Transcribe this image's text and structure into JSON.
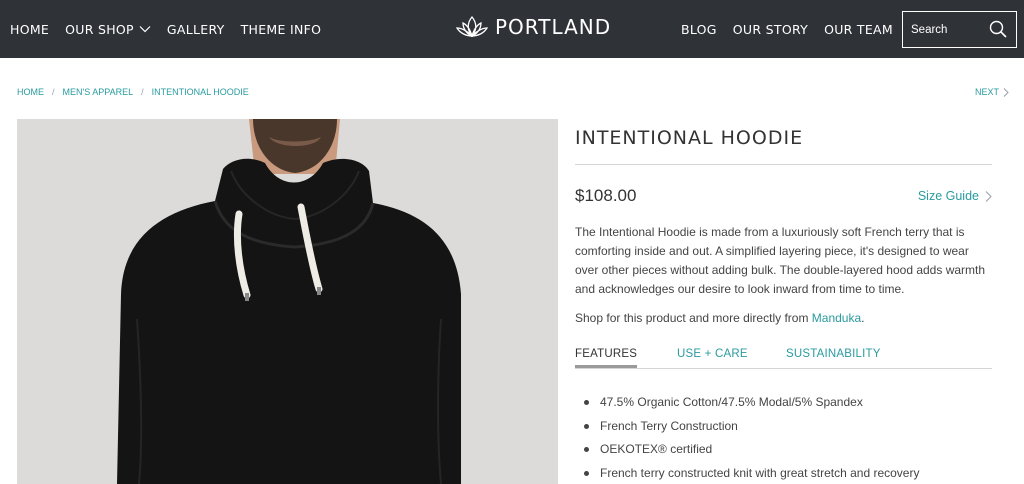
{
  "header": {
    "nav_left": [
      "HOME",
      "OUR SHOP",
      "GALLERY",
      "THEME INFO"
    ],
    "logo_text": "PORTLAND",
    "nav_right": [
      "BLOG",
      "OUR STORY",
      "OUR TEAM"
    ],
    "search_placeholder": "Search"
  },
  "breadcrumb": [
    "HOME",
    "MEN'S APPAREL",
    "INTENTIONAL HOODIE"
  ],
  "next_label": "NEXT",
  "product": {
    "title": "INTENTIONAL HOODIE",
    "price": "$108.00",
    "size_guide": "Size Guide",
    "description": "The Intentional Hoodie is made from a luxuriously soft French terry that is comforting inside and out. A simplified layering piece, it's designed to wear over other pieces without adding bulk. The double-layered hood adds warmth and acknowledges our desire to look inward from time to time.",
    "shop_prefix": "Shop for this product and more directly from ",
    "shop_link": "Manduka",
    "shop_suffix": "."
  },
  "tabs": [
    "FEATURES",
    "USE + CARE",
    "SUSTAINABILITY"
  ],
  "features": [
    "47.5% Organic Cotton/47.5% Modal/5% Spandex",
    "French Terry Construction",
    "OEKOTEX® certified",
    "French terry constructed knit with great stretch and recovery"
  ],
  "colors": {
    "header_bg": "#2f3237",
    "accent": "#2a9ba0",
    "text": "#333333"
  }
}
